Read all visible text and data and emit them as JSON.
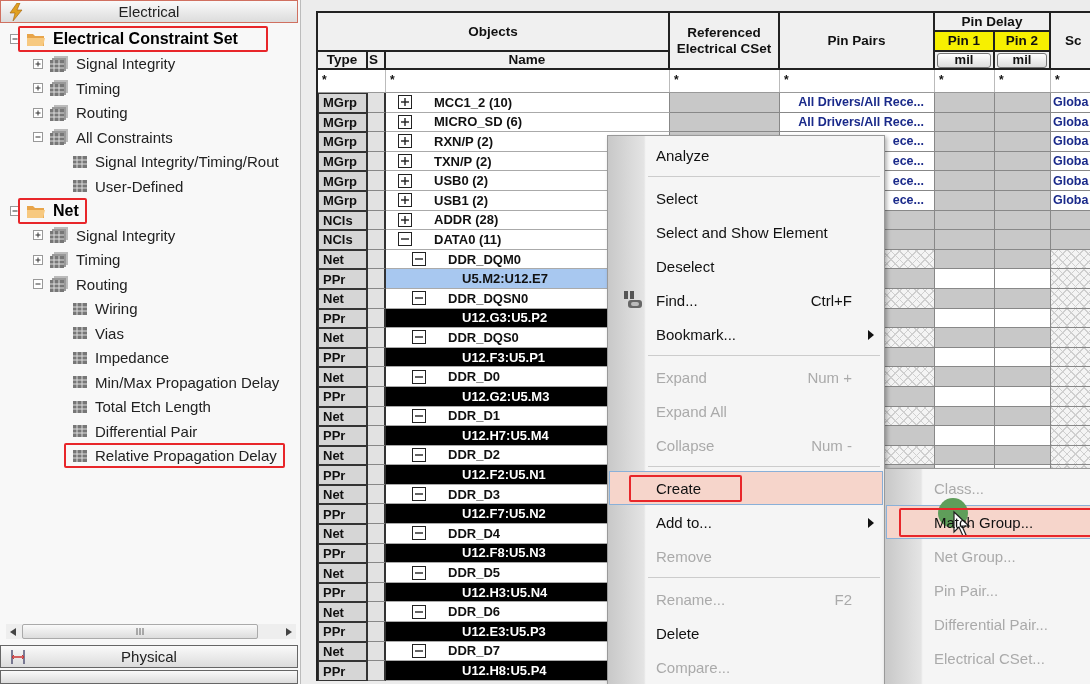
{
  "panel": {
    "tabs": [
      {
        "label": "Electrical",
        "selected": true
      }
    ],
    "tree": [
      {
        "label": "Electrical Constraint Set",
        "expanded": true,
        "annotated": true,
        "children": [
          {
            "label": "Signal Integrity",
            "expanded": false
          },
          {
            "label": "Timing",
            "expanded": false
          },
          {
            "label": "Routing",
            "expanded": false
          },
          {
            "label": "All Constraints",
            "expanded": true,
            "children": [
              {
                "label": "Signal Integrity/Timing/Rout",
                "annotated": false
              },
              {
                "label": "User-Defined",
                "annotated": false
              }
            ]
          }
        ]
      },
      {
        "label": "Net",
        "expanded": true,
        "annotated": true,
        "children": [
          {
            "label": "Signal Integrity",
            "expanded": false
          },
          {
            "label": "Timing",
            "expanded": false
          },
          {
            "label": "Routing",
            "expanded": true,
            "children": [
              {
                "label": "Wiring",
                "annotated": false
              },
              {
                "label": "Vias",
                "annotated": false
              },
              {
                "label": "Impedance",
                "annotated": false
              },
              {
                "label": "Min/Max Propagation Delay",
                "annotated": false
              },
              {
                "label": "Total Etch Length",
                "annotated": false
              },
              {
                "label": "Differential Pair",
                "annotated": false
              },
              {
                "label": "Relative Propagation Delay",
                "annotated": true
              }
            ]
          }
        ]
      }
    ],
    "bottom_tabs": [
      {
        "label": "Physical",
        "selected": false
      }
    ]
  },
  "table": {
    "header": {
      "objects": "Objects",
      "type": "Type",
      "s": "S",
      "name": "Name",
      "referenced": "Referenced Electrical CSet",
      "pin_pairs": "Pin Pairs",
      "pin_delay": "Pin Delay",
      "pin_1": "Pin 1",
      "pin_2": "Pin 2",
      "units": [
        "mil",
        "mil"
      ],
      "column_8": "Sc"
    },
    "filters": [
      "*",
      "*",
      "*",
      "*",
      "*",
      "*",
      "*"
    ],
    "rows": [
      {
        "type": "MGrp",
        "name": "MCC1_2 (10)",
        "expanded": false,
        "selected": false,
        "focused": false,
        "pin_pairs": "All Drivers/All Rece...",
        "scope": "Globa"
      },
      {
        "type": "MGrp",
        "name": "MICRO_SD (6)",
        "expanded": false,
        "selected": false,
        "focused": false,
        "pin_pairs": "All Drivers/All Rece...",
        "scope": "Globa"
      },
      {
        "type": "MGrp",
        "name": "RXN/P (2)",
        "expanded": false,
        "selected": false,
        "focused": false,
        "pin_pairs": "ece...",
        "scope": "Globa"
      },
      {
        "type": "MGrp",
        "name": "TXN/P (2)",
        "expanded": false,
        "selected": false,
        "focused": false,
        "pin_pairs": "ece...",
        "scope": "Globa"
      },
      {
        "type": "MGrp",
        "name": "USB0 (2)",
        "expanded": false,
        "selected": false,
        "focused": false,
        "pin_pairs": "ece...",
        "scope": "Globa"
      },
      {
        "type": "MGrp",
        "name": "USB1 (2)",
        "expanded": false,
        "selected": false,
        "focused": false,
        "pin_pairs": "ece...",
        "scope": "Globa"
      },
      {
        "type": "NCls",
        "name": "ADDR (28)",
        "expanded": false,
        "selected": false,
        "focused": false
      },
      {
        "type": "NCls",
        "name": "DATA0 (11)",
        "expanded": true,
        "selected": false,
        "focused": false,
        "children": [
          {
            "type": "Net",
            "name": "DDR_DQM0",
            "expanded": true,
            "selected": false,
            "focused": false,
            "children": [
              {
                "type": "PPr",
                "name": "U5.M2:U12.E7",
                "selected": true,
                "focused": true
              }
            ]
          },
          {
            "type": "Net",
            "name": "DDR_DQSN0",
            "expanded": true,
            "selected": false,
            "focused": false,
            "children": [
              {
                "type": "PPr",
                "name": "U12.G3:U5.P2",
                "selected": true,
                "focused": false
              }
            ]
          },
          {
            "type": "Net",
            "name": "DDR_DQS0",
            "expanded": true,
            "selected": false,
            "focused": false,
            "children": [
              {
                "type": "PPr",
                "name": "U12.F3:U5.P1",
                "selected": true,
                "focused": false
              }
            ]
          },
          {
            "type": "Net",
            "name": "DDR_D0",
            "expanded": true,
            "selected": false,
            "focused": false,
            "children": [
              {
                "type": "PPr",
                "name": "U12.G2:U5.M3",
                "selected": true,
                "focused": false
              }
            ]
          },
          {
            "type": "Net",
            "name": "DDR_D1",
            "expanded": true,
            "selected": false,
            "focused": false,
            "children": [
              {
                "type": "PPr",
                "name": "U12.H7:U5.M4",
                "selected": true,
                "focused": false
              }
            ]
          },
          {
            "type": "Net",
            "name": "DDR_D2",
            "expanded": true,
            "selected": false,
            "focused": false,
            "children": [
              {
                "type": "PPr",
                "name": "U12.F2:U5.N1",
                "selected": true,
                "focused": false
              }
            ]
          },
          {
            "type": "Net",
            "name": "DDR_D3",
            "expanded": true,
            "selected": false,
            "focused": false,
            "children": [
              {
                "type": "PPr",
                "name": "U12.F7:U5.N2",
                "selected": true,
                "focused": false
              }
            ]
          },
          {
            "type": "Net",
            "name": "DDR_D4",
            "expanded": true,
            "selected": false,
            "focused": false,
            "children": [
              {
                "type": "PPr",
                "name": "U12.F8:U5.N3",
                "selected": true,
                "focused": false
              }
            ]
          },
          {
            "type": "Net",
            "name": "DDR_D5",
            "expanded": true,
            "selected": false,
            "focused": false,
            "children": [
              {
                "type": "PPr",
                "name": "U12.H3:U5.N4",
                "selected": true,
                "focused": false
              }
            ]
          },
          {
            "type": "Net",
            "name": "DDR_D6",
            "expanded": true,
            "selected": false,
            "focused": false,
            "children": [
              {
                "type": "PPr",
                "name": "U12.E3:U5.P3",
                "selected": true,
                "focused": false
              }
            ]
          },
          {
            "type": "Net",
            "name": "DDR_D7",
            "expanded": true,
            "selected": false,
            "focused": false,
            "children": [
              {
                "type": "PPr",
                "name": "U12.H8:U5.P4",
                "selected": true,
                "focused": false
              }
            ]
          }
        ]
      }
    ]
  },
  "context_menu": {
    "items": [
      {
        "kind": "item",
        "label": "Analyze",
        "disabled": false,
        "selected": false,
        "annotated": false,
        "submenu": false
      },
      {
        "kind": "separator"
      },
      {
        "kind": "item",
        "label": "Select",
        "disabled": false,
        "selected": false,
        "annotated": false,
        "submenu": false
      },
      {
        "kind": "item",
        "label": "Select and Show Element",
        "disabled": false,
        "selected": false,
        "annotated": false,
        "submenu": false
      },
      {
        "kind": "item",
        "label": "Deselect",
        "disabled": false,
        "selected": false,
        "annotated": false,
        "submenu": false
      },
      {
        "kind": "icon_item",
        "label": "Find...",
        "shortcut": "Ctrl+F",
        "disabled": false,
        "selected": false,
        "annotated": false,
        "submenu": false
      },
      {
        "kind": "item",
        "label": "Bookmark...",
        "disabled": false,
        "selected": false,
        "annotated": false,
        "submenu": true
      },
      {
        "kind": "separator"
      },
      {
        "kind": "item",
        "label": "Expand",
        "shortcut": "Num +",
        "disabled": true,
        "selected": false,
        "annotated": false,
        "submenu": false
      },
      {
        "kind": "item",
        "label": "Expand All",
        "disabled": true,
        "selected": false,
        "annotated": false,
        "submenu": false
      },
      {
        "kind": "item",
        "label": "Collapse",
        "shortcut": "Num -",
        "disabled": true,
        "selected": false,
        "annotated": false,
        "submenu": false
      },
      {
        "kind": "separator"
      },
      {
        "kind": "item",
        "label": "Create",
        "disabled": false,
        "selected": true,
        "annotated": true,
        "submenu": false
      },
      {
        "kind": "item",
        "label": "Add to...",
        "disabled": false,
        "selected": false,
        "annotated": false,
        "submenu": true
      },
      {
        "kind": "item",
        "label": "Remove",
        "disabled": true,
        "selected": false,
        "annotated": false,
        "submenu": false
      },
      {
        "kind": "separator"
      },
      {
        "kind": "item",
        "label": "Rename...",
        "shortcut": "F2",
        "disabled": true,
        "selected": false,
        "annotated": false,
        "submenu": false
      },
      {
        "kind": "item",
        "label": "Delete",
        "disabled": false,
        "selected": false,
        "annotated": false,
        "submenu": false
      },
      {
        "kind": "item",
        "label": "Compare...",
        "disabled": true,
        "selected": false,
        "annotated": false,
        "submenu": false
      }
    ]
  },
  "submenu": {
    "items": [
      {
        "kind": "item",
        "label": "Class...",
        "disabled": true,
        "selected": false,
        "annotated": false,
        "submenu": false
      },
      {
        "kind": "item",
        "label": "Match Group...",
        "disabled": false,
        "selected": true,
        "annotated": true,
        "submenu": false
      },
      {
        "kind": "item",
        "label": "Net Group...",
        "disabled": true,
        "selected": false,
        "annotated": false,
        "submenu": false
      },
      {
        "kind": "item",
        "label": "Pin Pair...",
        "disabled": true,
        "selected": false,
        "annotated": false,
        "submenu": false
      },
      {
        "kind": "item",
        "label": "Differential Pair...",
        "disabled": true,
        "selected": false,
        "annotated": false,
        "submenu": false
      },
      {
        "kind": "item",
        "label": "Electrical CSet...",
        "disabled": true,
        "selected": false,
        "annotated": false,
        "submenu": false
      }
    ]
  }
}
